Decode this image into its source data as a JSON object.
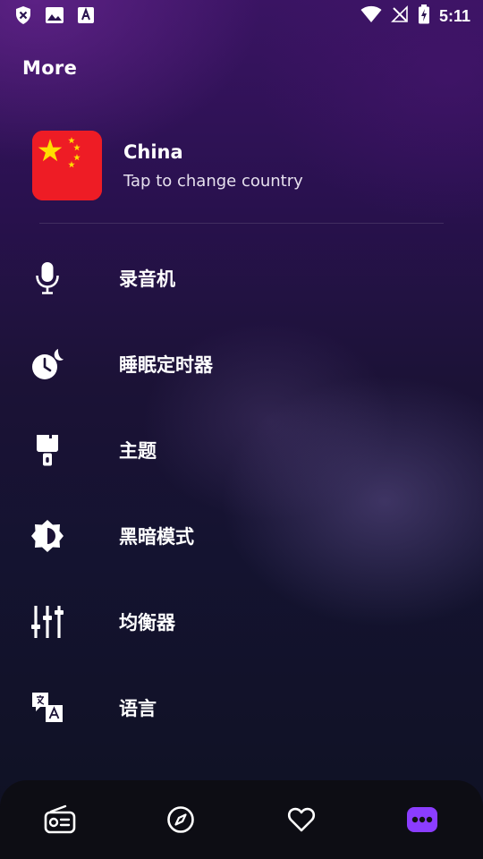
{
  "status_bar": {
    "time": "5:11"
  },
  "header": {
    "title": "More"
  },
  "country": {
    "name": "China",
    "subtitle": "Tap to change country"
  },
  "menu": [
    {
      "label": "录音机",
      "icon": "microphone-icon"
    },
    {
      "label": "睡眠定时器",
      "icon": "sleep-timer-icon"
    },
    {
      "label": "主题",
      "icon": "paint-brush-icon"
    },
    {
      "label": "黑暗模式",
      "icon": "dark-mode-icon"
    },
    {
      "label": "均衡器",
      "icon": "equalizer-icon"
    },
    {
      "label": "语言",
      "icon": "translate-icon"
    }
  ],
  "bottom_nav": [
    {
      "icon": "radio-icon",
      "active": false
    },
    {
      "icon": "compass-icon",
      "active": false
    },
    {
      "icon": "heart-icon",
      "active": false
    },
    {
      "icon": "more-dots-icon",
      "active": true
    }
  ],
  "colors": {
    "accent": "#8b3dff",
    "flag_red": "#ee1c25",
    "flag_star": "#ffde00"
  }
}
